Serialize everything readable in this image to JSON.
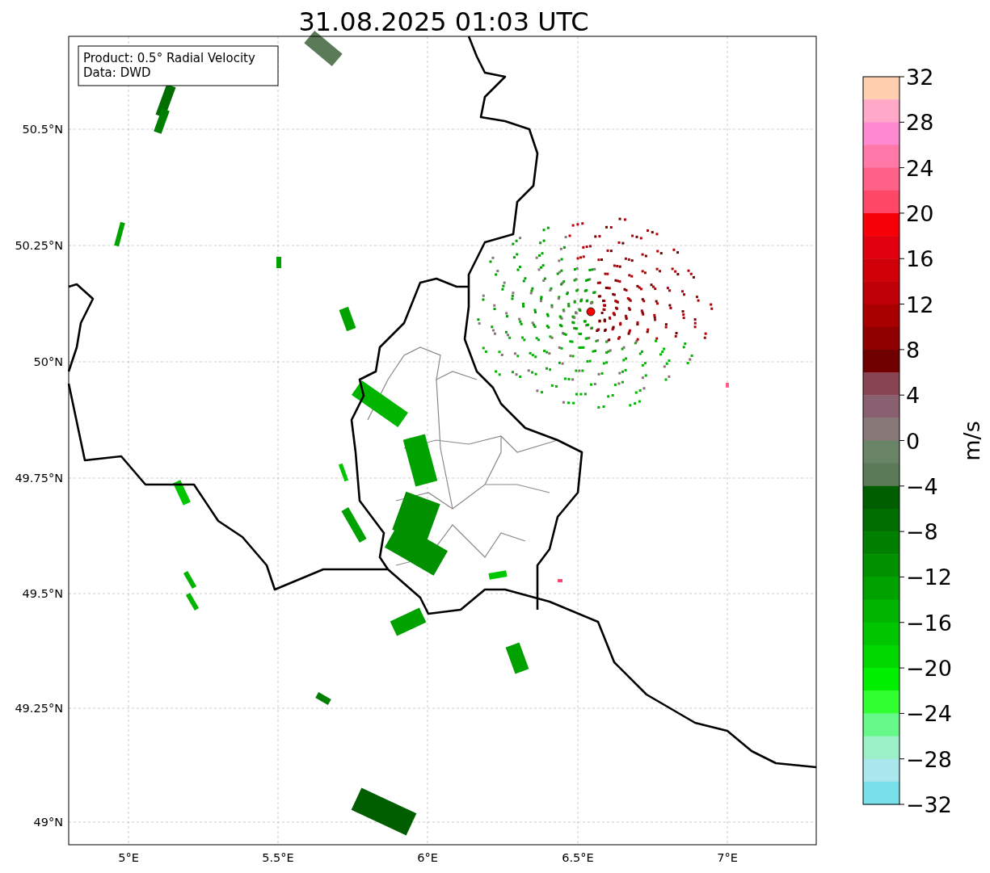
{
  "title": "31.08.2025 01:03 UTC",
  "legend": [
    "Product: 0.5° Radial Velocity",
    "Data: DWD"
  ],
  "map": {
    "x_ticks": [
      "5°E",
      "5.5°E",
      "6°E",
      "6.5°E",
      "7°E"
    ],
    "y_ticks": [
      "50.5°N",
      "50.25°N",
      "50°N",
      "49.75°N",
      "49.5°N",
      "49.25°N",
      "49°N"
    ]
  },
  "colorbar": {
    "label": "m/s",
    "ticks": [
      "32",
      "28",
      "24",
      "20",
      "16",
      "12",
      "8",
      "4",
      "0",
      "−4",
      "−8",
      "−12",
      "−16",
      "−20",
      "−24",
      "−28",
      "−32"
    ],
    "segments": [
      {
        "color": "#ffcfb0"
      },
      {
        "color": "#ffa8c8"
      },
      {
        "color": "#ff88d0"
      },
      {
        "color": "#ff78a8"
      },
      {
        "color": "#ff6088"
      },
      {
        "color": "#ff4868"
      },
      {
        "color": "#f80008"
      },
      {
        "color": "#e00010"
      },
      {
        "color": "#d00008"
      },
      {
        "color": "#c00008"
      },
      {
        "color": "#a80000"
      },
      {
        "color": "#900000"
      },
      {
        "color": "#700000"
      },
      {
        "color": "#884450"
      },
      {
        "color": "#886070"
      },
      {
        "color": "#887878"
      },
      {
        "color": "#6a8468"
      },
      {
        "color": "#5a7a58"
      },
      {
        "color": "#005e00"
      },
      {
        "color": "#006e00"
      },
      {
        "color": "#007f00"
      },
      {
        "color": "#009000"
      },
      {
        "color": "#00a200"
      },
      {
        "color": "#00b400"
      },
      {
        "color": "#00c600"
      },
      {
        "color": "#00d800"
      },
      {
        "color": "#00f000"
      },
      {
        "color": "#30ff30"
      },
      {
        "color": "#66f888"
      },
      {
        "color": "#9cf0c8"
      },
      {
        "color": "#aae8ee"
      },
      {
        "color": "#78e0e8"
      }
    ]
  }
}
